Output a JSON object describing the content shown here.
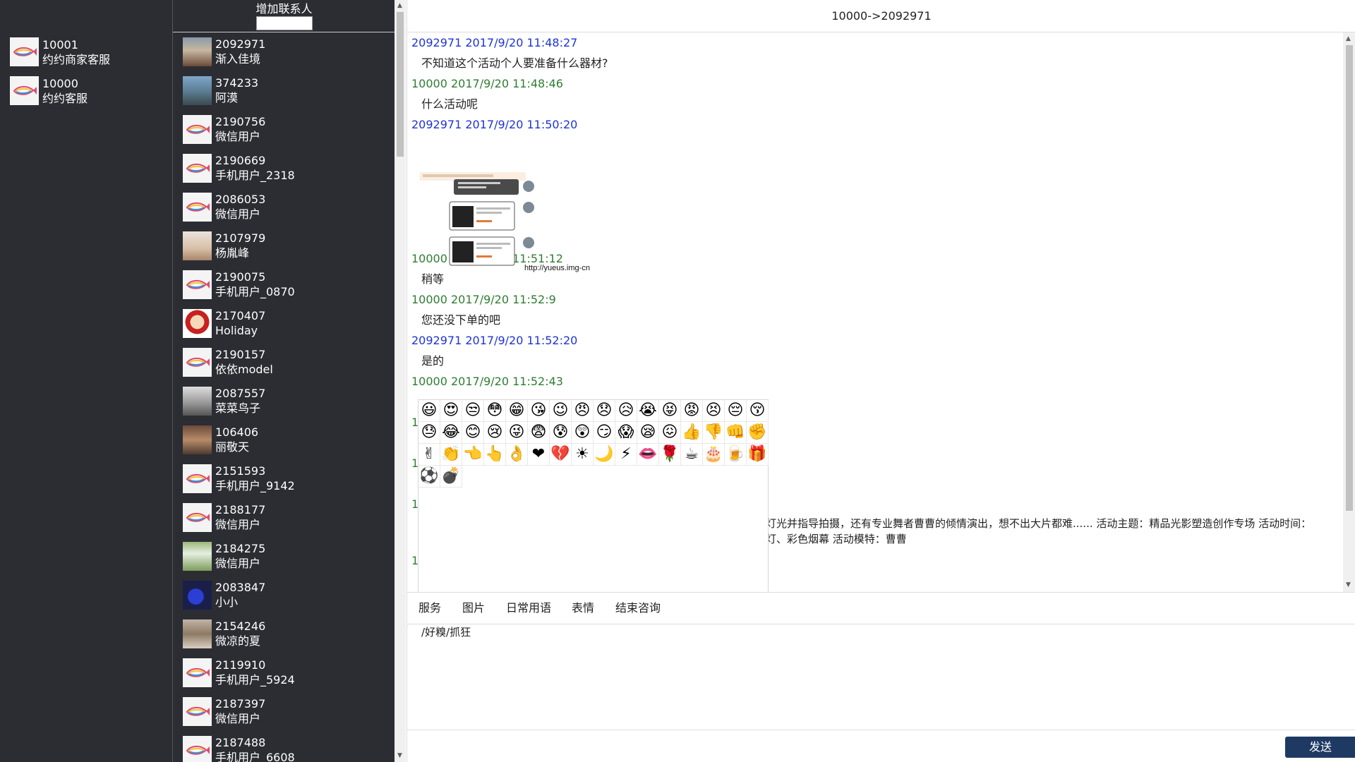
{
  "accounts": [
    {
      "id": "10001",
      "name": "约约商家客服"
    },
    {
      "id": "10000",
      "name": "约约客服"
    }
  ],
  "contacts_header": {
    "add_label": "增加联系人",
    "add_placeholder": ""
  },
  "contacts": [
    {
      "id": "2092971",
      "name": "渐入佳境",
      "avatar": "photo-a"
    },
    {
      "id": "374233",
      "name": "阿漠",
      "avatar": "photo-b"
    },
    {
      "id": "2190756",
      "name": "微信用户",
      "avatar": "fish-logo"
    },
    {
      "id": "2190669",
      "name": "手机用户_2318",
      "avatar": "fish-logo"
    },
    {
      "id": "2086053",
      "name": "微信用户",
      "avatar": "fish-logo"
    },
    {
      "id": "2107979",
      "name": "杨胤峰",
      "avatar": "photo-c"
    },
    {
      "id": "2190075",
      "name": "手机用户_0870",
      "avatar": "fish-logo"
    },
    {
      "id": "2170407",
      "name": "Holiday",
      "avatar": "photo-d"
    },
    {
      "id": "2190157",
      "name": "依依model",
      "avatar": "fish-logo"
    },
    {
      "id": "2087557",
      "name": "菜菜鸟子",
      "avatar": "photo-e"
    },
    {
      "id": "106406",
      "name": "丽敬天",
      "avatar": "photo-f"
    },
    {
      "id": "2151593",
      "name": "手机用户_9142",
      "avatar": "fish-logo"
    },
    {
      "id": "2188177",
      "name": "微信用户",
      "avatar": "fish-logo"
    },
    {
      "id": "2184275",
      "name": "微信用户",
      "avatar": "photo-g"
    },
    {
      "id": "2083847",
      "name": "小小",
      "avatar": "photo-h"
    },
    {
      "id": "2154246",
      "name": "微凉的夏",
      "avatar": "photo-i"
    },
    {
      "id": "2119910",
      "name": "手机用户_5924",
      "avatar": "fish-logo"
    },
    {
      "id": "2187397",
      "name": "微信用户",
      "avatar": "fish-logo"
    },
    {
      "id": "2187488",
      "name": "手机用户_6608",
      "avatar": "fish-logo"
    }
  ],
  "chat": {
    "title": "10000->2092971",
    "messages": [
      {
        "sender": "2092971",
        "time": "2017/9/20 11:48:27",
        "text": "不知道这个活动个人要准备什么器材?",
        "side": "them"
      },
      {
        "sender": "10000",
        "time": "2017/9/20 11:48:46",
        "text": "什么活动呢",
        "side": "me"
      },
      {
        "sender": "2092971",
        "time": "2017/9/20 11:50:20",
        "text": "",
        "side": "them",
        "image_url": "http://yueus.img-cn"
      },
      {
        "sender": "10000",
        "time": "2017/9/20 11:51:12",
        "text": "稍等",
        "side": "me"
      },
      {
        "sender": "10000",
        "time": "2017/9/20 11:52:9",
        "text": "您还没下单的吧",
        "side": "me"
      },
      {
        "sender": "2092971",
        "time": "2017/9/20 11:52:20",
        "text": "是的",
        "side": "them"
      },
      {
        "sender": "10000",
        "time": "2017/9/20 11:52:43",
        "text": "",
        "side": "me"
      }
    ],
    "hidden_meta_fragments": [
      "1",
      "1",
      "1",
      "1"
    ],
    "long_text_line1": "灯光并指导拍摄，还有专业舞者曹曹的倾情演出，想不出大片都难...... 活动主题：精品光影塑造创作专场 活动时间：",
    "long_text_line2": "灯、彩色烟幕 活动模特：曹曹"
  },
  "emoji_picker": {
    "emojis": [
      "😃",
      "😍",
      "😒",
      "😳",
      "😁",
      "😘",
      "😉",
      "😠",
      "😞",
      "😥",
      "😭",
      "😝",
      "😡",
      "😣",
      "😔",
      "😚",
      "😓",
      "😂",
      "😊",
      "😢",
      "😜",
      "😨",
      "😰",
      "😲",
      "😏",
      "😱",
      "😪",
      "😖",
      "👍",
      "👎",
      "👊",
      "✊",
      "✌",
      "👏",
      "👈",
      "👆",
      "👌",
      "❤",
      "💔",
      "☀",
      "🌙",
      "⚡",
      "👄",
      "🌹",
      "☕",
      "🎂",
      "🍺",
      "🎁",
      "⚽",
      "💣"
    ]
  },
  "toolbar": {
    "items": [
      "服务",
      "图片",
      "日常用语",
      "表情",
      "结束咨询"
    ]
  },
  "compose": {
    "value": "/好糗/抓狂"
  },
  "send": {
    "label": "发送"
  },
  "colors": {
    "sidebar_bg": "#2b2d33",
    "them_meta": "#1f33d6",
    "me_meta": "#2e7d32",
    "send_btn": "#1e3a63"
  }
}
